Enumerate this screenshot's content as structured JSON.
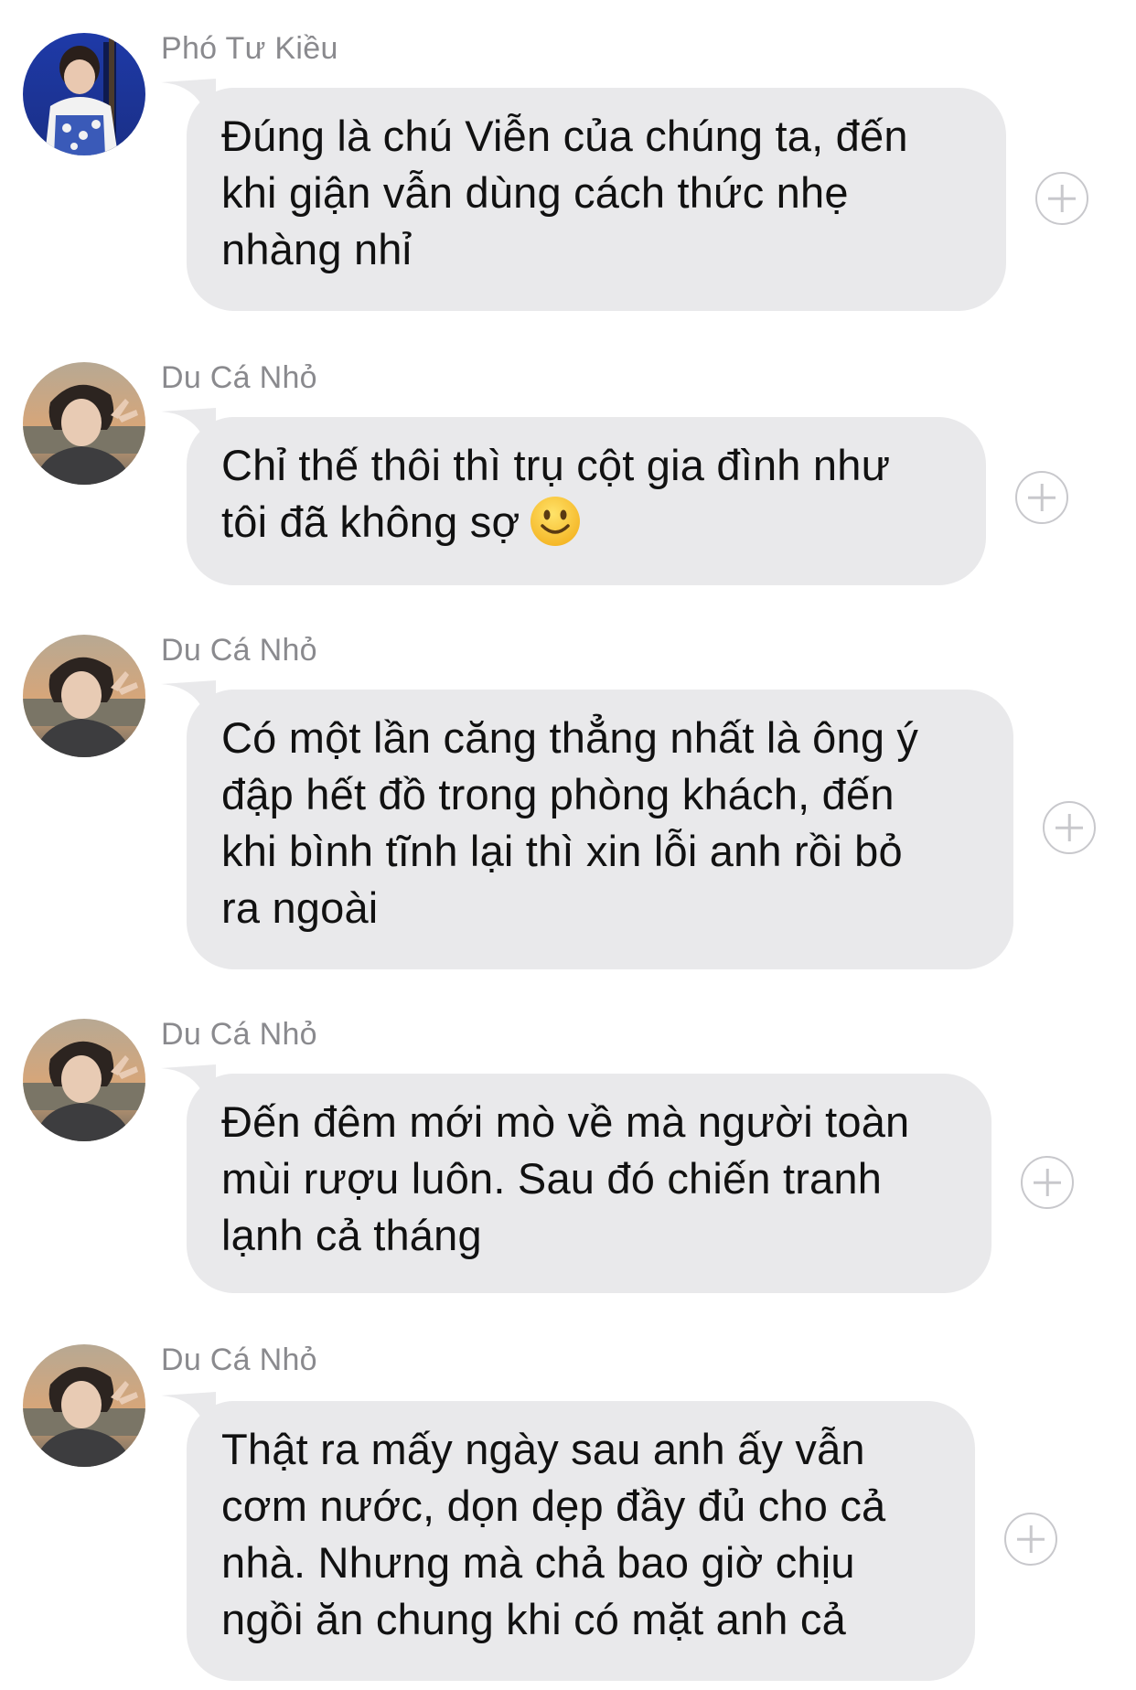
{
  "messages": [
    {
      "sender": "Phó Tư Kiều",
      "avatar_icon": "user-avatar-photo",
      "lines": [
        "Đúng là chú Viễn của chúng ta, đến",
        "khi giận vẫn dùng cách thức nhẹ",
        "nhàng nhỉ"
      ],
      "action_icon": "plus-circle-icon"
    },
    {
      "sender": "Du Cá Nhỏ",
      "avatar_icon": "user-avatar-photo",
      "lines": [
        "Chỉ thế thôi thì trụ cột gia đình như",
        "tôi đã không sợ"
      ],
      "emoji": "slightly-smiling-face-icon",
      "action_icon": "plus-circle-icon"
    },
    {
      "sender": "Du Cá Nhỏ",
      "avatar_icon": "user-avatar-photo",
      "lines": [
        "Có một lần căng thẳng nhất là ông ý",
        "đập hết đồ trong phòng khách, đến",
        "khi bình tĩnh lại thì xin lỗi anh rồi bỏ",
        "ra ngoài"
      ],
      "action_icon": "plus-circle-icon"
    },
    {
      "sender": "Du Cá Nhỏ",
      "avatar_icon": "user-avatar-photo",
      "lines": [
        "Đến đêm mới mò về mà người toàn",
        "mùi rượu luôn. Sau đó chiến tranh",
        "lạnh cả tháng"
      ],
      "action_icon": "plus-circle-icon"
    },
    {
      "sender": "Du Cá Nhỏ",
      "avatar_icon": "user-avatar-photo",
      "lines": [
        "Thật ra mấy ngày sau anh ấy vẫn",
        "cơm nước, dọn dẹp đầy đủ cho cả",
        "nhà. Nhưng mà chả bao giờ chịu",
        "ngồi ăn chung khi có mặt anh cả"
      ],
      "action_icon": "plus-circle-icon"
    }
  ],
  "colors": {
    "bubble": "#e9e9eb",
    "sender_text": "#8a8a8e",
    "message_text": "#111111",
    "action_icon": "#c8c8cc"
  }
}
